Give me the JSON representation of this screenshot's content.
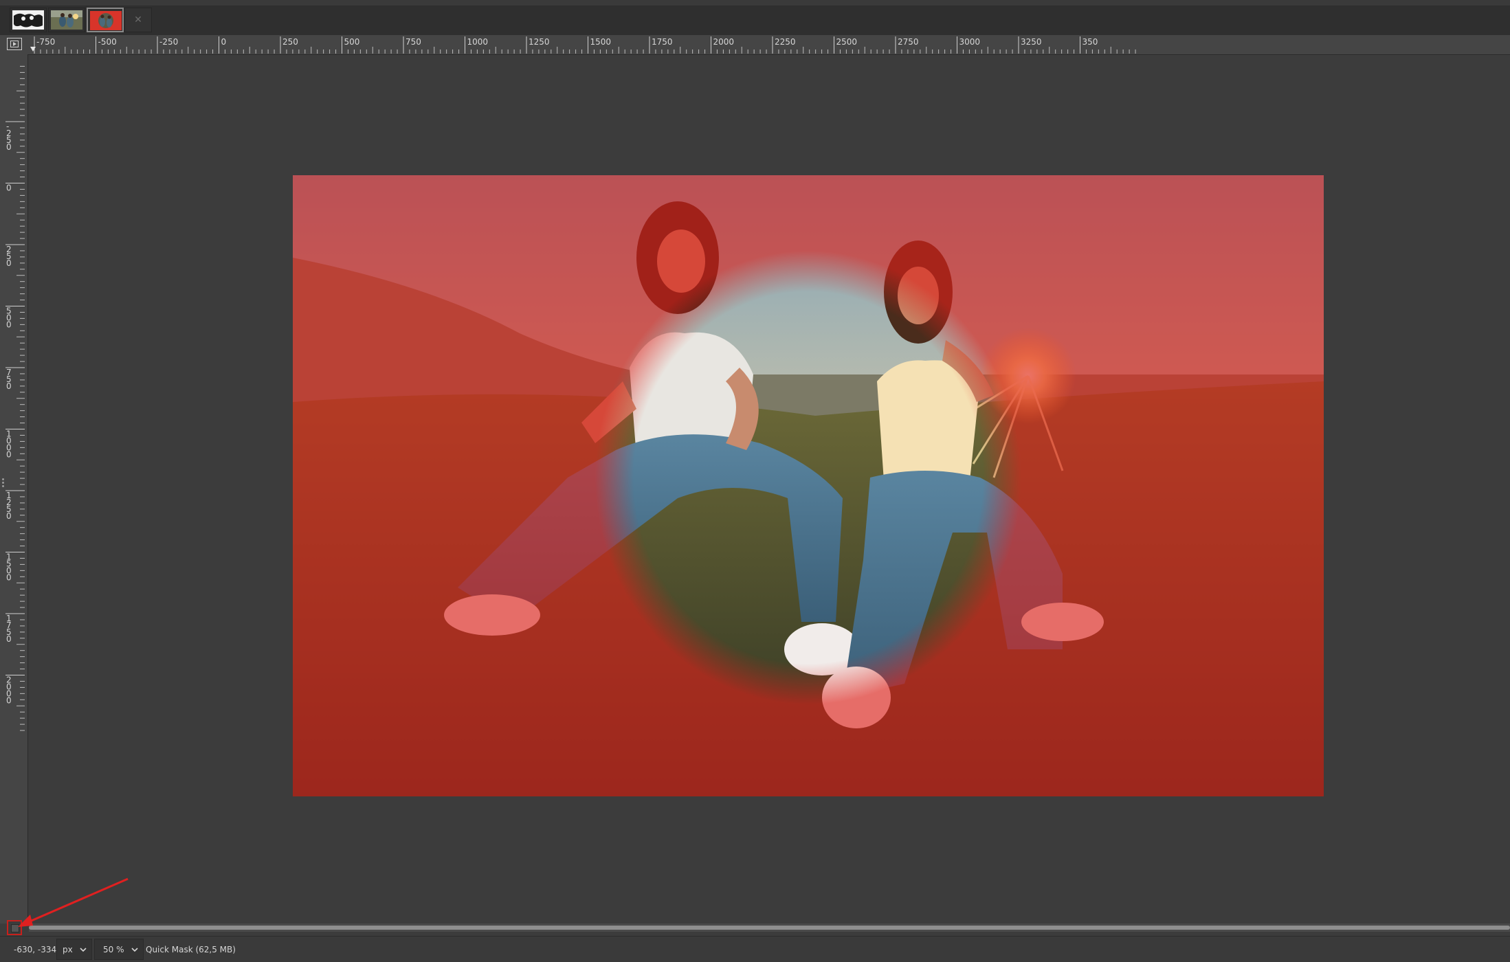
{
  "tabs": [
    {
      "name": "tab-image-1",
      "label": "Image 1 thumbnail"
    },
    {
      "name": "tab-image-2",
      "label": "Image 2 thumbnail"
    },
    {
      "name": "tab-image-3",
      "label": "Image 3 thumbnail (active)"
    }
  ],
  "tab_close_icon": "close-icon",
  "navigate_icon": "navigate-icon",
  "rulers": {
    "horizontal": [
      "-750",
      "-500",
      "-250",
      "0",
      "250",
      "500",
      "750",
      "1000",
      "1250",
      "1500",
      "1750",
      "2000",
      "2250",
      "2500",
      "2750",
      "3000",
      "3250",
      "350"
    ],
    "vertical": [
      "-250",
      "0",
      "250",
      "500",
      "750",
      "1000",
      "1250",
      "1500",
      "1750",
      "2000"
    ]
  },
  "canvas": {
    "description_icon": "photo",
    "quick_mask_color": "#e0201a"
  },
  "quick_mask_toggle_icon": "quick-mask-icon",
  "status": {
    "coordinates": "-630, -334",
    "unit": "px",
    "zoom": "50 %",
    "info": "Quick Mask (62,5 MB)"
  },
  "colors": {
    "annotation_arrow": "#e02020",
    "background": "#3c3c3c"
  }
}
